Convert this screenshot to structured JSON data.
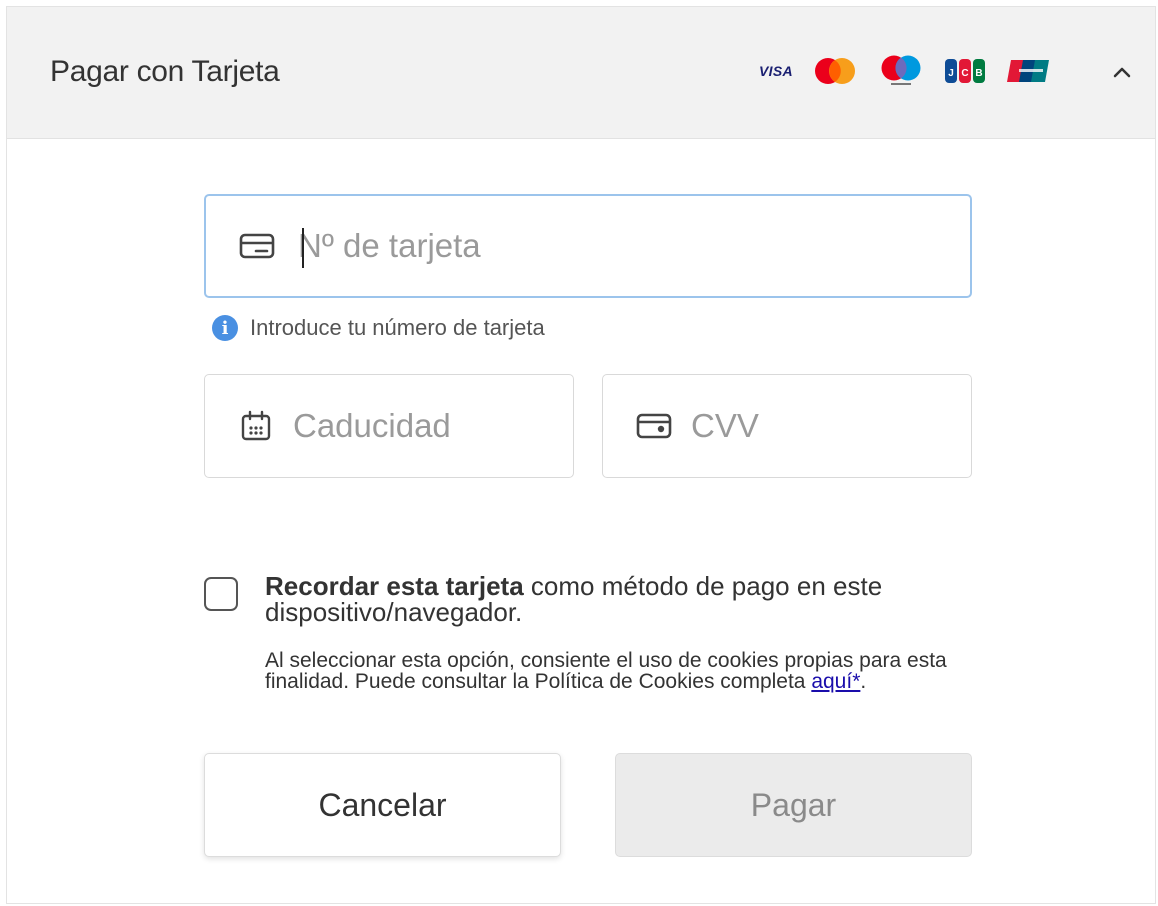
{
  "header": {
    "title": "Pagar con Tarjeta",
    "brands": [
      {
        "name": "visa",
        "label": "VISA"
      },
      {
        "name": "mastercard",
        "label": ""
      },
      {
        "name": "maestro",
        "label": ""
      },
      {
        "name": "jcb",
        "label": ""
      },
      {
        "name": "unionpay",
        "label": ""
      }
    ],
    "toggle_icon": "chevron-up-icon"
  },
  "form": {
    "card_number": {
      "placeholder": "Nº de tarjeta",
      "value": "",
      "icon": "credit-card-icon",
      "hint": "Introduce tu número de tarjeta",
      "hint_icon": "info-icon"
    },
    "expiry": {
      "placeholder": "Caducidad",
      "value": "",
      "icon": "calendar-icon"
    },
    "cvv": {
      "placeholder": "CVV",
      "value": "",
      "icon": "card-cvv-icon"
    }
  },
  "remember": {
    "checked": false,
    "bold_text": "Recordar esta tarjeta",
    "text": " como método de pago en este dispositivo/navegador.",
    "consent_text": "Al seleccionar esta opción, consiente el uso de cookies propias para esta finalidad. Puede consultar la Política de Cookies completa ",
    "link_text": "aquí*",
    "consent_end": "."
  },
  "buttons": {
    "cancel_label": "Cancelar",
    "pay_label": "Pagar"
  },
  "colors": {
    "header_bg": "#f2f2f2",
    "active_border": "#9cc4ec",
    "info_blue": "#4a90e2",
    "link": "#1a0dab",
    "pay_disabled_bg": "#ebebeb"
  }
}
